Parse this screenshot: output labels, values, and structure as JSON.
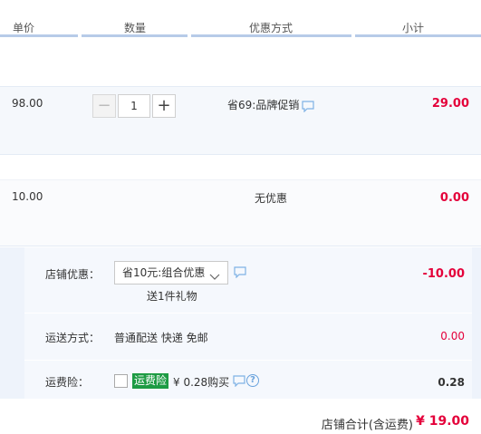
{
  "header": {
    "col_price": "单价",
    "col_qty": "数量",
    "col_promo": "优惠方式",
    "col_subtotal": "小计"
  },
  "items": [
    {
      "price": "98.00",
      "quantity": "1",
      "decrease": "−",
      "increase": "+",
      "promo": "省69:品牌促销",
      "subtotal": "29.00"
    },
    {
      "price": "10.00",
      "promo": "无优惠",
      "subtotal": "0.00"
    }
  ],
  "shop": {
    "discount_label": "店铺优惠：",
    "discount_select": "省10元:组合优惠",
    "gift_text": "送1件礼物",
    "discount_amount": "-10.00",
    "shipping_label": "运送方式：",
    "shipping_text": "普通配送 快递 免邮",
    "shipping_amount": "0.00",
    "insurance_label": "运费险：",
    "insurance_badge": "运费险",
    "insurance_price": "¥ 0.28购买",
    "insurance_amount": "0.28",
    "help_glyph": "?"
  },
  "total": {
    "label": "店铺合计(含运费)",
    "amount": "¥ 19.00"
  },
  "colors": {
    "price_red": "#e4003a",
    "header_line": "#b7cbe8",
    "badge_green": "#1d9b43",
    "icon_blue": "#6aa3dd"
  },
  "icons": [
    "chat-icon",
    "chevron-down-icon",
    "help-icon"
  ]
}
